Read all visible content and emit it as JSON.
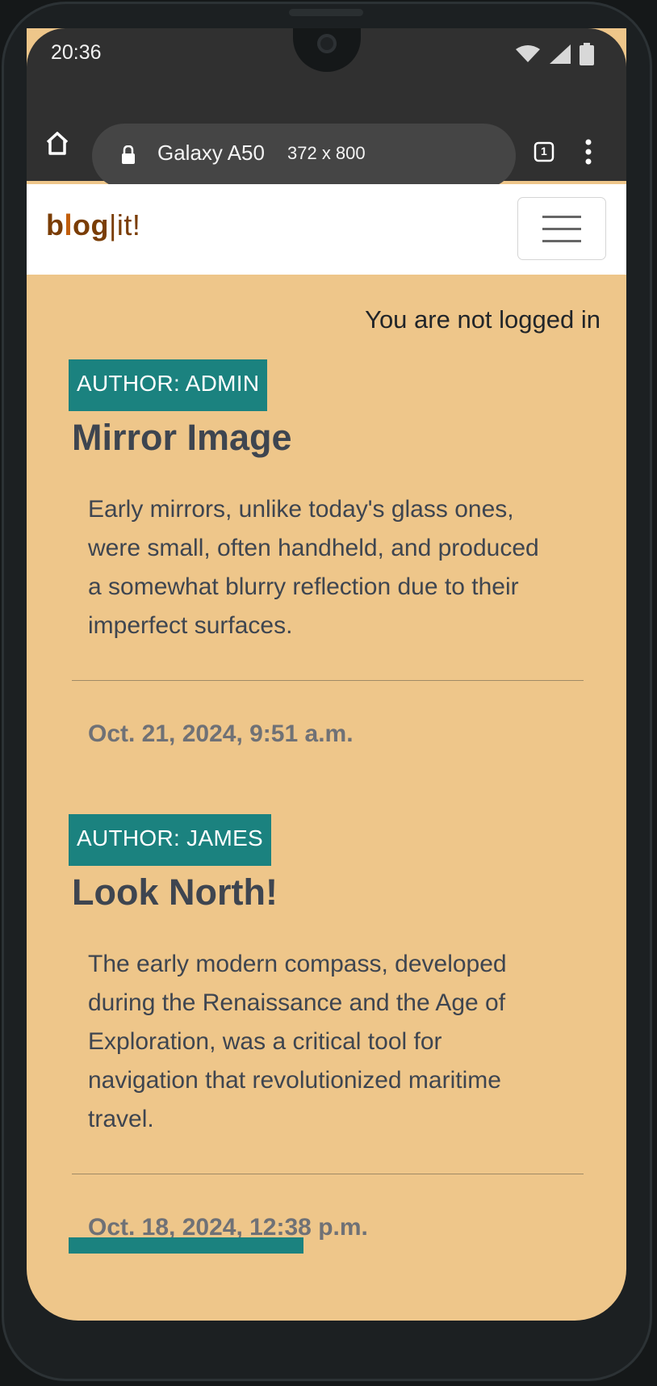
{
  "status_bar": {
    "time": "20:36"
  },
  "browser": {
    "device_name": "Galaxy A50",
    "device_size": "372 x 800",
    "tab_count": "1"
  },
  "navbar": {
    "brand_part1": "b",
    "brand_part2": "l",
    "brand_part3": "og",
    "brand_rest": "|it!"
  },
  "page": {
    "login_status": "You are not logged in"
  },
  "posts": [
    {
      "author": "AUTHOR: ADMIN",
      "title": "Mirror Image",
      "body": "Early mirrors, unlike today's glass ones, were small, often handheld, and produced a somewhat blurry reflection due to their imperfect surfaces.",
      "date": "Oct. 21, 2024, 9:51 a.m."
    },
    {
      "author": "AUTHOR: JAMES",
      "title": "Look North!",
      "body": "The early modern compass, developed during the Renaissance and the Age of Exploration, was a critical tool for navigation that revolutionized maritime travel.",
      "date": "Oct. 18, 2024, 12:38 p.m."
    }
  ],
  "colors": {
    "page_bg": "#eec68a",
    "author_badge": "#1b827f",
    "brand_dark": "#7a3d05",
    "brand_accent": "#c25e0b",
    "browser_chrome": "#303030"
  }
}
